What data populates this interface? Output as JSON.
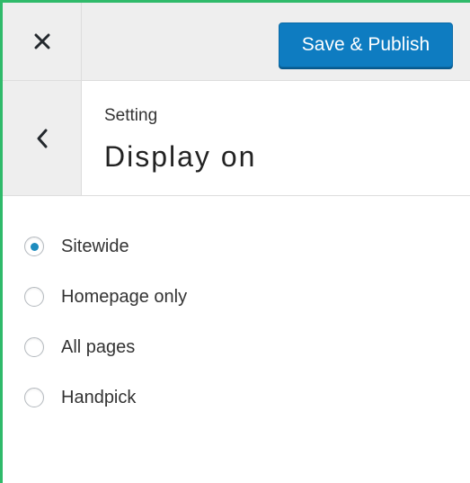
{
  "topbar": {
    "close_icon": "close-icon",
    "publish_label": "Save & Publish"
  },
  "section": {
    "back_icon": "chevron-left-icon",
    "crumb": "Setting",
    "title": "Display on"
  },
  "options": {
    "selected": "Sitewide",
    "items": [
      {
        "label": "Sitewide",
        "checked": true
      },
      {
        "label": "Homepage only",
        "checked": false
      },
      {
        "label": "All pages",
        "checked": false
      },
      {
        "label": "Handpick",
        "checked": false
      }
    ]
  },
  "colors": {
    "accent": "#0e7cc1",
    "radio_selected": "#1e8cbe",
    "frame_border": "#2fba6a",
    "panel_bg": "#eeeeee"
  }
}
